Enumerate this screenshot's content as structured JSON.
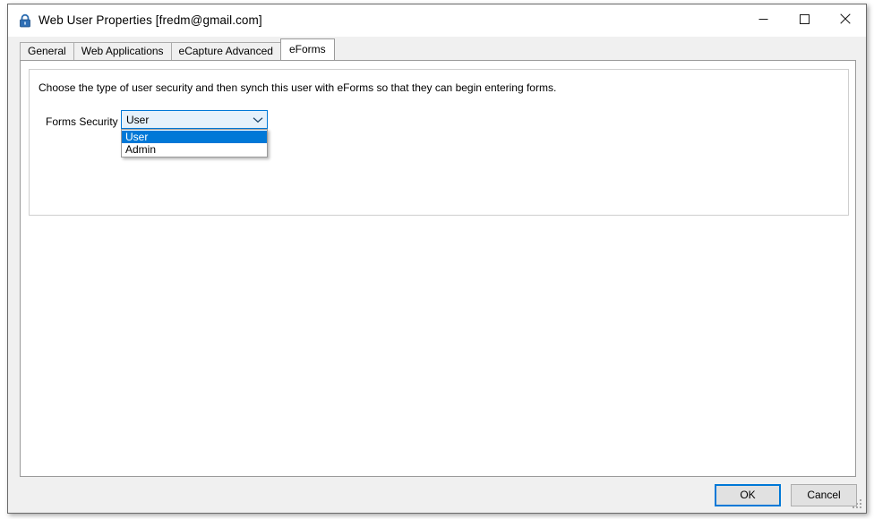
{
  "window": {
    "title": "Web User Properties [fredm@gmail.com]",
    "icon": "padlock-icon",
    "controls": {
      "minimize": "minimize-icon",
      "maximize": "maximize-icon",
      "close": "close-icon"
    }
  },
  "tabs": [
    {
      "label": "General",
      "active": false
    },
    {
      "label": "Web Applications",
      "active": false
    },
    {
      "label": "eCapture Advanced",
      "active": false
    },
    {
      "label": "eForms",
      "active": true
    }
  ],
  "panel": {
    "instruction": "Choose the type of user security and then synch this user with eForms so that they can begin entering forms."
  },
  "form": {
    "forms_security": {
      "label": "Forms Security",
      "value": "User",
      "expanded": true,
      "options": [
        {
          "label": "User",
          "selected": true
        },
        {
          "label": "Admin",
          "selected": false
        }
      ]
    }
  },
  "footer": {
    "ok_label": "OK",
    "cancel_label": "Cancel"
  },
  "colors": {
    "accent": "#0078d7",
    "window_bg": "#f0f0f0",
    "page_bg": "#ffffff",
    "border": "#9a9a9a",
    "combo_bg": "#e5f1fb"
  }
}
